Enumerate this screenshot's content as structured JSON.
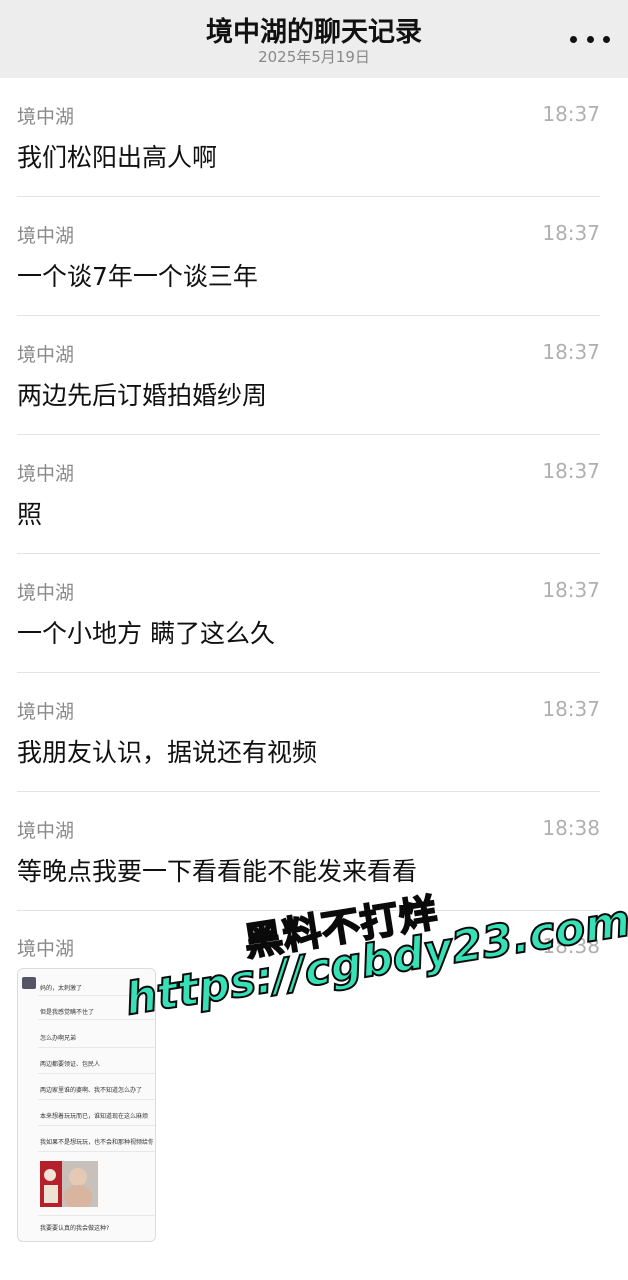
{
  "header": {
    "title": "境中湖的聊天记录",
    "date": "2025年5月19日",
    "more_icon": "more-horizontal-icon"
  },
  "messages": [
    {
      "sender": "境中湖",
      "time": "18:37",
      "text": "我们松阳出高人啊"
    },
    {
      "sender": "境中湖",
      "time": "18:37",
      "text": "一个谈7年一个谈三年"
    },
    {
      "sender": "境中湖",
      "time": "18:37",
      "text": "两边先后订婚拍婚纱周"
    },
    {
      "sender": "境中湖",
      "time": "18:37",
      "text": "照"
    },
    {
      "sender": "境中湖",
      "time": "18:37",
      "text": "一个小地方 瞒了这么久"
    },
    {
      "sender": "境中湖",
      "time": "18:37",
      "text": "我朋友认识，据说还有视频"
    },
    {
      "sender": "境中湖",
      "time": "18:38",
      "text": "等晚点我要一下看看能不能发来看看"
    }
  ],
  "last_message": {
    "sender": "境中湖",
    "time": "18:38",
    "attachment_rows": [
      "妈的，太刺激了",
      "但是我感觉瞒不住了",
      "怎么办啊兄弟",
      "两边都要领证、包民人",
      "两边家里谁的婆啊、我不知道怎么办了",
      "本来想着玩玩而已，谁知道现在这么麻烦",
      "我如果不是想玩玩，也不会和那种视频给你看",
      "我要要认真的我会做这种?"
    ]
  },
  "watermark": {
    "line1": "黑料不打烊",
    "line2": "https://cgbdy23.com"
  }
}
